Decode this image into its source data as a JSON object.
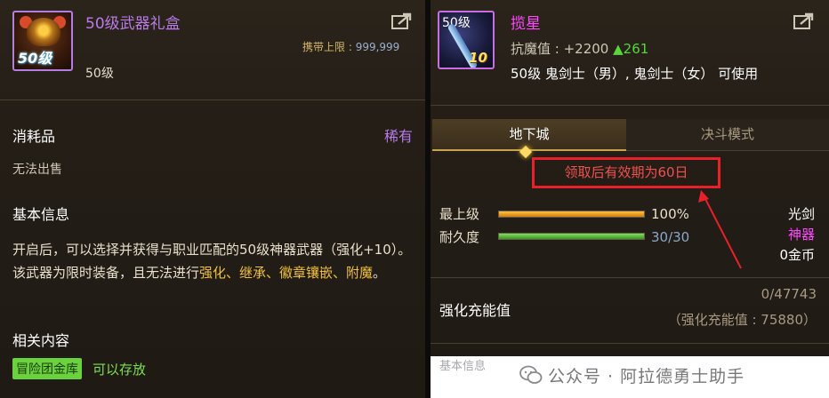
{
  "left": {
    "item_level_badge": "50级",
    "item_name": "50级武器礼盒",
    "carry_limit_label": "携带上限 :",
    "carry_limit_value": "999,999",
    "level_req": "50级",
    "category": "消耗品",
    "rarity": "稀有",
    "sell_status": "无法出售",
    "basic_info_head": "基本信息",
    "desc_part1": "开启后，可以选择并获得与职业匹配的50级神器武器（强化+10）。该武器为限时装备，且无法进行",
    "desc_highlight": "强化、继承、徽章镶嵌、附魔",
    "desc_part2": "。",
    "related_head": "相关内容",
    "related_tag": "冒险团金库",
    "related_action": "可以存放"
  },
  "right": {
    "icon_level": "50级",
    "icon_enhance": "10",
    "item_name": "揽星",
    "resist_label": "抗魔值 : +2200",
    "resist_bonus": "▲261",
    "usage": "50级 鬼剑士（男）, 鬼剑士（女） 可使用",
    "tabs": [
      "地下城",
      "决斗模式"
    ],
    "annotation": "领取后有效期为60日",
    "stats": [
      {
        "label": "最上级",
        "value": "100%",
        "fill": 1.0
      },
      {
        "label": "耐久度",
        "value": "30/30",
        "fill": 1.0
      }
    ],
    "weapon_type": "光剑",
    "weapon_grade": "神器",
    "price": "0金币",
    "enhance_label": "强化充能值",
    "enhance_value": "0/47743",
    "enhance_sub": "（强化充能值 : 75880）",
    "partial_text": "基本信息"
  },
  "watermark": {
    "text": "公众号 · 阿拉德勇士助手"
  },
  "colors": {
    "purple_title": "#b87be8",
    "magenta_title": "#ff48ff",
    "gold": "#d4b56a",
    "green": "#7de04d",
    "annotation_red": "#e8202a",
    "bar_orange": "#f0a020",
    "bar_green": "#58c838"
  },
  "icons": [
    "share-icon",
    "wechat-icon"
  ]
}
